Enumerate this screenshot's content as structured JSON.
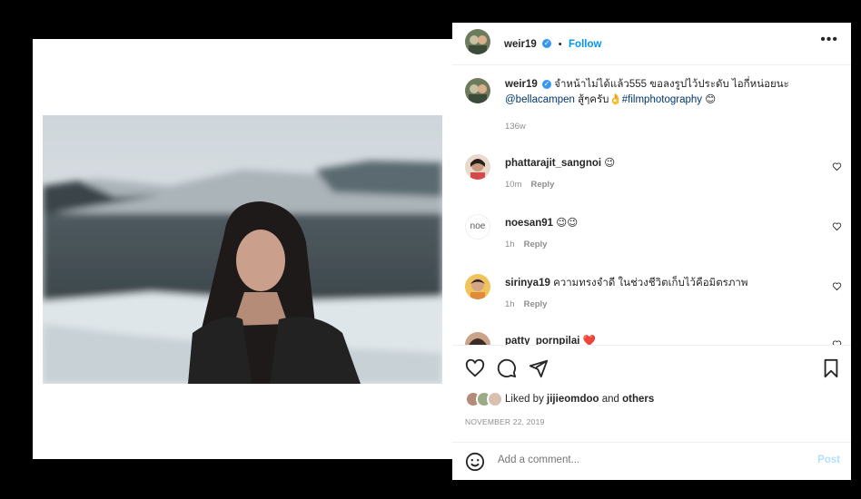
{
  "post": {
    "username": "weir19",
    "follow_label": "Follow",
    "separator": "•",
    "more_label": "•••",
    "caption_user": "weir19",
    "caption_text": "จำหน้าไม่ได้แล้ว555 ขอลงรูปไว้ประดับ ไอกี่หน่อยนะ",
    "caption_mention": "@bellacampen",
    "caption_text2": " สู้ๆครับ👌",
    "caption_hashtag": "#filmphotography",
    "caption_emoji": "😊",
    "caption_time": "136w",
    "liked_by_prefix": "Liked by",
    "liked_by_user": "jijieomdoo",
    "liked_by_and": "and",
    "liked_by_others": "others",
    "date": "NOVEMBER 22, 2019",
    "comment_placeholder": "Add a comment...",
    "post_label": "Post"
  },
  "comments": [
    {
      "user": "phattarajit_sangnoi",
      "text": " 😉",
      "time": "10m",
      "reply": "Reply"
    },
    {
      "user": "noesan91",
      "text": " 😉😉",
      "time": "1h",
      "reply": "Reply",
      "avatar_text": "noe"
    },
    {
      "user": "sirinya19",
      "text": " ความทรงจำดี ในช่วงชีวิตเก็บไว้คือมิตรภาพ",
      "time": "1h",
      "reply": "Reply"
    },
    {
      "user": "patty_pornpilai",
      "text": " ❤️"
    }
  ],
  "colors": {
    "accent": "#0095f6",
    "verified": "#3897f0",
    "text": "#262626",
    "muted": "#8e8e8e"
  }
}
